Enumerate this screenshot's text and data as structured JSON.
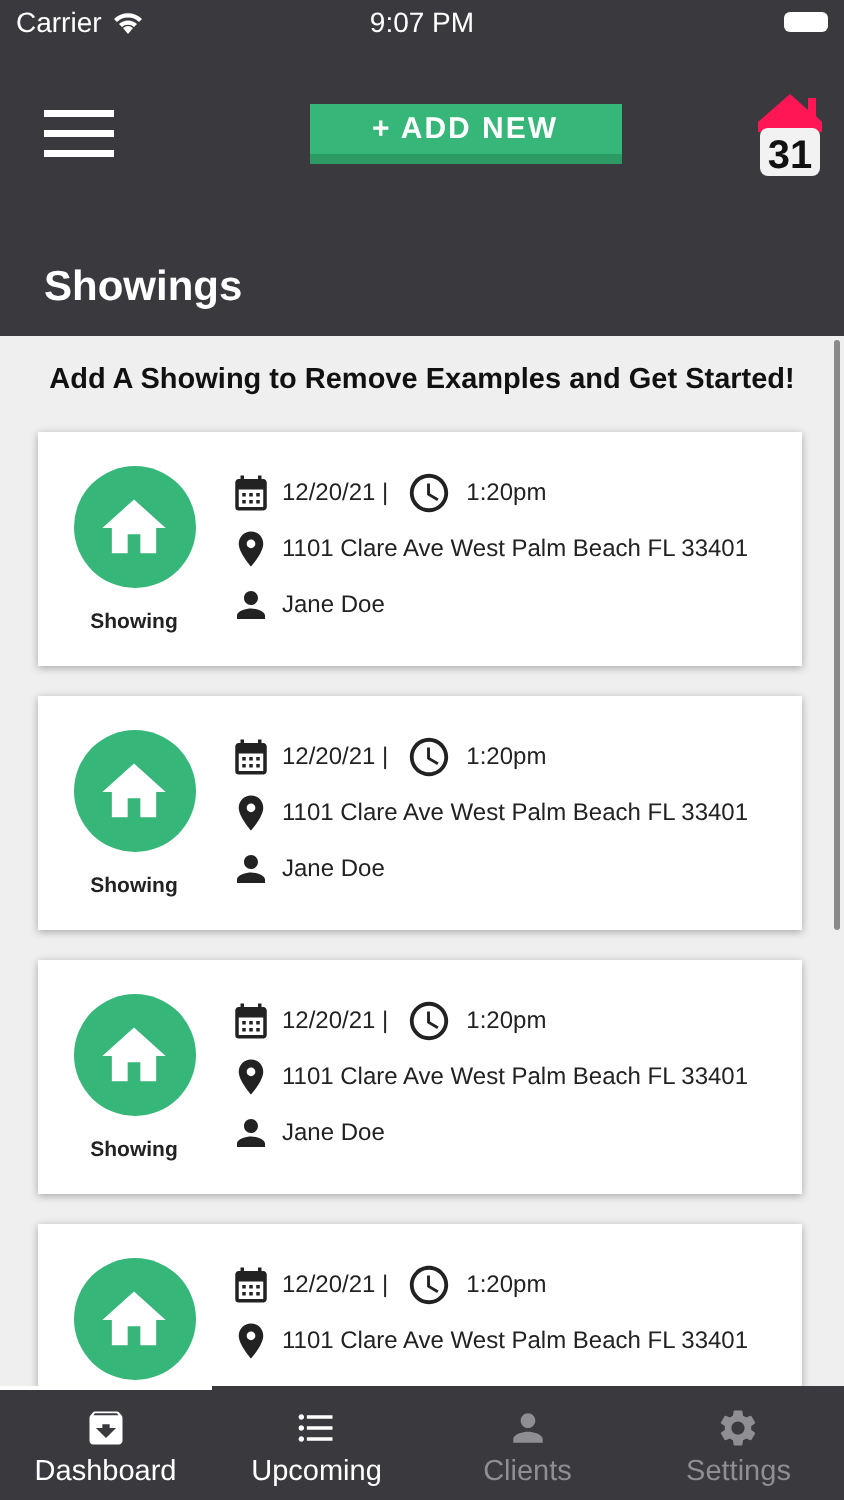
{
  "status_bar": {
    "carrier": "Carrier",
    "time": "9:07 PM"
  },
  "header": {
    "add_button": "+ ADD NEW",
    "logo_text": "31",
    "title": "Showings"
  },
  "prompt": "Add A Showing to Remove Examples and Get Started!",
  "showings": [
    {
      "label": "Showing",
      "date": "12/20/21 |",
      "time": "1:20pm",
      "address": "1101 Clare Ave West Palm Beach FL 33401",
      "client": "Jane Doe"
    },
    {
      "label": "Showing",
      "date": "12/20/21 |",
      "time": "1:20pm",
      "address": "1101 Clare Ave West Palm Beach FL 33401",
      "client": "Jane Doe"
    },
    {
      "label": "Showing",
      "date": "12/20/21 |",
      "time": "1:20pm",
      "address": "1101 Clare Ave West Palm Beach FL 33401",
      "client": "Jane Doe"
    },
    {
      "date": "12/20/21 |",
      "time": "1:20pm",
      "address": "1101 Clare Ave West Palm Beach FL 33401"
    }
  ],
  "tabs": [
    {
      "kind": "dashboard",
      "label": "Dashboard",
      "selected": true,
      "dimmed": false
    },
    {
      "kind": "upcoming",
      "label": "Upcoming",
      "selected": false,
      "dimmed": false
    },
    {
      "kind": "clients",
      "label": "Clients",
      "selected": false,
      "dimmed": true
    },
    {
      "kind": "settings",
      "label": "Settings",
      "selected": false,
      "dimmed": true
    }
  ]
}
